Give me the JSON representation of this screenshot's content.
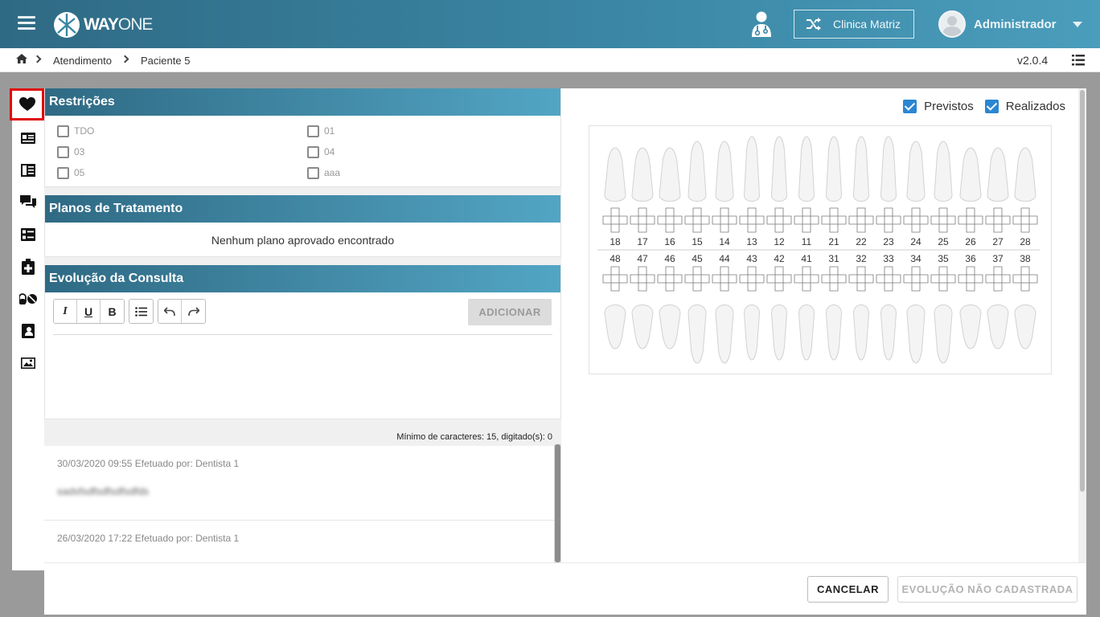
{
  "brand": {
    "logo_part1": "WAY",
    "logo_part2": "ONE"
  },
  "header": {
    "clinic_label": "Clinica Matriz",
    "user_name": "Administrador"
  },
  "breadcrumb": {
    "items": [
      "Atendimento",
      "Paciente 5"
    ]
  },
  "version": "v2.0.4",
  "rail": {
    "items": [
      "heart-icon",
      "id-card-icon",
      "record-icon",
      "chat-icon",
      "checklist-icon",
      "medkit-icon",
      "pills-icon",
      "contact-icon",
      "image-icon"
    ],
    "active_index": 0
  },
  "restricoes": {
    "title": "Restrições",
    "options": [
      "TDO",
      "01",
      "03",
      "04",
      "05",
      "aaa"
    ]
  },
  "planos": {
    "title": "Planos de Tratamento",
    "empty_message": "Nenhum plano aprovado encontrado"
  },
  "evolucao": {
    "title": "Evolução da Consulta",
    "toolbar": {
      "italic": "I",
      "underline": "U",
      "bold": "B"
    },
    "add_label": "ADICIONAR",
    "char_counter": "Mínimo de caracteres: 15, digitado(s): 0",
    "history": [
      {
        "meta": "30/03/2020 09:55 Efetuado por: Dentista 1",
        "text": "sadsfsdfsdfsdfsdfds"
      },
      {
        "meta": "26/03/2020 17:22 Efetuado por: Dentista 1",
        "text": ""
      }
    ]
  },
  "odontogram": {
    "legend": {
      "previstos": "Previstos",
      "realizados": "Realizados"
    },
    "upper_teeth": [
      "18",
      "17",
      "16",
      "15",
      "14",
      "13",
      "12",
      "11",
      "21",
      "22",
      "23",
      "24",
      "25",
      "26",
      "27",
      "28"
    ],
    "lower_teeth": [
      "48",
      "47",
      "46",
      "45",
      "44",
      "43",
      "42",
      "41",
      "31",
      "32",
      "33",
      "34",
      "35",
      "36",
      "37",
      "38"
    ]
  },
  "footer": {
    "cancel_label": "CANCELAR",
    "save_label": "EVOLUÇÃO NÃO CADASTRADA"
  },
  "colors": {
    "header_start": "#2f6a84",
    "header_end": "#4b9dbc",
    "checkbox": "#2a86d2",
    "active_outline": "#e00b0b"
  }
}
